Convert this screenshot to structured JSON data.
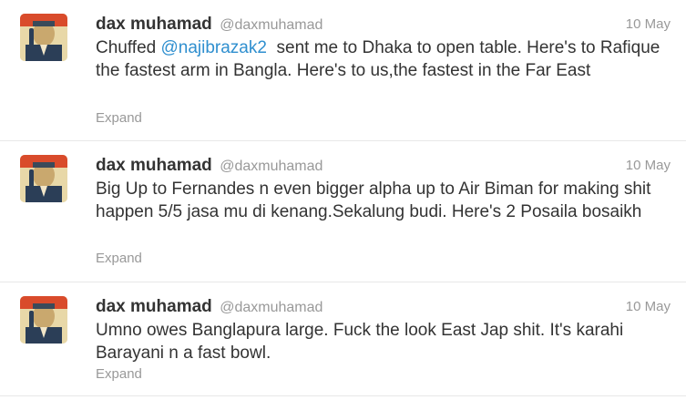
{
  "tweets": [
    {
      "name": "dax muhamad",
      "handle": "@daxmuhamad",
      "time": "10 May",
      "text_pre": "Chuffed ",
      "mention": "@najibrazak2",
      "text_post": "  sent me to Dhaka to open table. Here's to Rafique the fastest arm in Bangla. Here's to us,the fastest in the Far East",
      "expand_label": "Expand"
    },
    {
      "name": "dax muhamad",
      "handle": "@daxmuhamad",
      "time": "10 May",
      "text": "Big Up to Fernandes n even bigger alpha up to Air Biman for making shit happen 5/5 jasa mu di kenang.Sekalung budi. Here's 2 Posaila bosaikh",
      "expand_label": "Expand"
    },
    {
      "name": "dax muhamad",
      "handle": "@daxmuhamad",
      "time": "10 May",
      "text": "Umno owes Banglapura large. Fuck the look East Jap shit. It's karahi Barayani n a fast bowl.",
      "expand_label": "Expand"
    }
  ],
  "colors": {
    "name": "#333333",
    "meta": "#999999",
    "mention": "#2f8fcf",
    "divider": "#e8e8e8"
  },
  "icons": {
    "avatar": "avatar-portrait-icon"
  }
}
